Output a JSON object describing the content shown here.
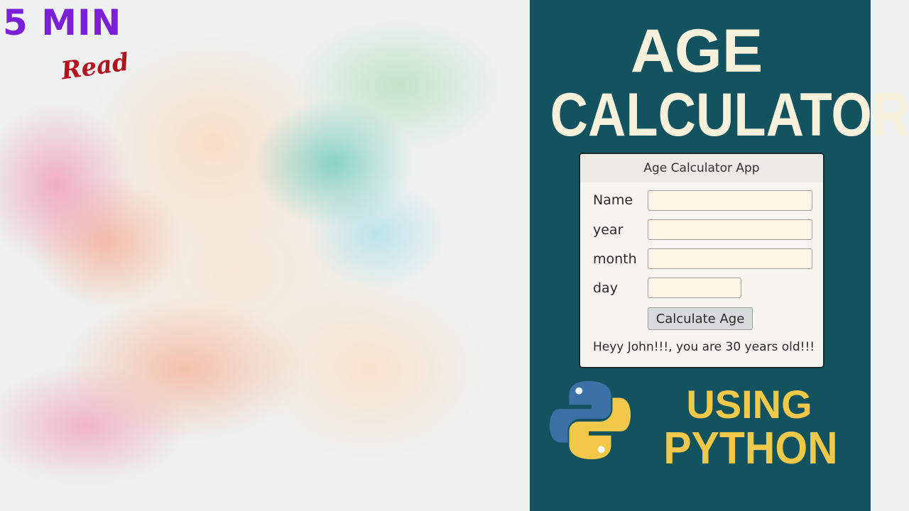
{
  "badge": {
    "minutes": "5 MIN",
    "read": "Read"
  },
  "headline": {
    "line1": "AGE",
    "line2": "CALCULATOR"
  },
  "app": {
    "window_title": "Age Calculator App",
    "fields": [
      {
        "label": "Name",
        "value": ""
      },
      {
        "label": "year",
        "value": ""
      },
      {
        "label": "month",
        "value": ""
      },
      {
        "label": "day",
        "value": ""
      }
    ],
    "button_label": "Calculate Age",
    "result_text": "Heyy John!!!, you are 30 years old!!!"
  },
  "footer": {
    "line1": "USING",
    "line2": "PYTHON",
    "logo": "python-logo"
  },
  "colors": {
    "panel": "#12535f",
    "title_text": "#f7f1dc",
    "accent_yellow": "#f2c84a",
    "badge_purple": "#7b1fd8",
    "badge_red": "#b3121f",
    "python_blue": "#3a72a8",
    "python_yellow": "#f2c84a"
  }
}
